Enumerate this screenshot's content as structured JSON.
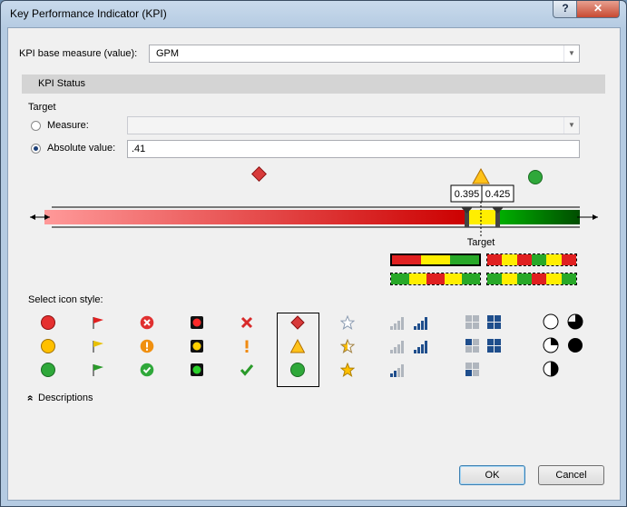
{
  "window": {
    "title": "Key Performance Indicator (KPI)",
    "help_glyph": "?",
    "close_glyph": "✕"
  },
  "base_measure": {
    "label": "KPI base measure (value):",
    "value": "GPM"
  },
  "section": {
    "title": "KPI Status"
  },
  "target": {
    "heading": "Target",
    "measure_label": "Measure:",
    "measure_value": "",
    "absolute_label": "Absolute value:",
    "absolute_value": ".41",
    "selected": "absolute"
  },
  "gauge": {
    "threshold_low": "0.395",
    "threshold_high": "0.425",
    "target_label": "Target",
    "colors": {
      "red": "#cc0000",
      "pink": "#ff9999",
      "yellow": "#ffee00",
      "green": "#009a00",
      "dark_green": "#004d00"
    }
  },
  "band_patterns": [
    [
      "red",
      "yellow",
      "green"
    ],
    [
      "red",
      "yellow",
      "red",
      "green",
      "yellow",
      "red"
    ],
    [
      "green",
      "yellow",
      "red",
      "yellow",
      "green"
    ],
    [
      "green",
      "yellow",
      "green",
      "red",
      "yellow",
      "green"
    ]
  ],
  "icon_style": {
    "label": "Select icon style:",
    "selected_column": 5,
    "columns": [
      [
        "red-circle-icon",
        "yellow-circle-icon",
        "green-circle-icon"
      ],
      [
        "red-flag-icon",
        "yellow-flag-icon",
        "green-flag-icon"
      ],
      [
        "red-x-circle-icon",
        "orange-exclamation-circle-icon",
        "green-check-circle-icon"
      ],
      [
        "red-light-icon",
        "yellow-light-icon",
        "green-light-icon"
      ],
      [
        "red-x-icon",
        "orange-exclamation-icon",
        "green-check-icon"
      ],
      [
        "red-diamond-icon",
        "yellow-triangle-icon",
        "green-circle-icon"
      ],
      [
        "empty-star-icon",
        "half-star-icon",
        "full-star-icon"
      ],
      [
        "signal-1-icon",
        "signal-2-icon",
        "signal-3-icon"
      ],
      [
        "grid-1-icon",
        "grid-2-icon",
        "grid-3-icon"
      ],
      [
        "quarter-circle-icon",
        "three-quarter-circle-icon",
        "half-circle-icon"
      ]
    ]
  },
  "descriptions": {
    "glyph": "»",
    "label": "Descriptions"
  },
  "buttons": {
    "ok": "OK",
    "cancel": "Cancel"
  }
}
